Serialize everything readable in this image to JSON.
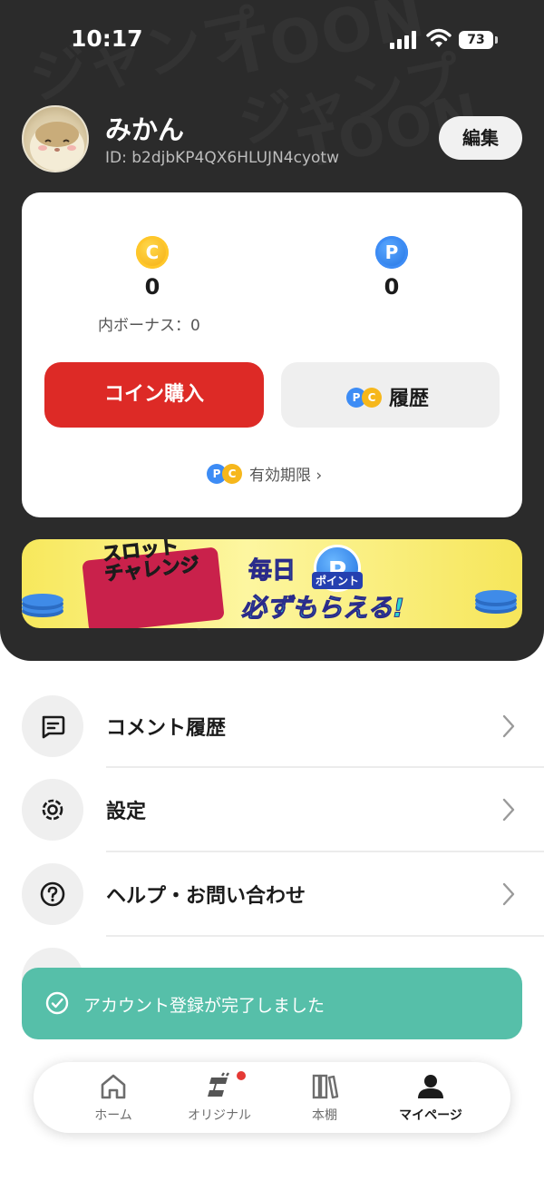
{
  "status_bar": {
    "time": "10:17",
    "battery": "73"
  },
  "profile": {
    "name": "みかん",
    "id": "ID: b2djbKP4QX6HLUJN4cyotw",
    "edit_label": "編集"
  },
  "background_words": [
    "ジャンプ",
    "TOON",
    "ジャンプ",
    "TOON",
    "ジャンプ"
  ],
  "balance": {
    "coin_icon": "C",
    "coin_value": "0",
    "coin_bonus": "内ボーナス：0",
    "point_icon": "P",
    "point_value": "0",
    "buy_label": "コイン購入",
    "history_label": "履歴",
    "expiry_label": "有効期限 ›"
  },
  "banner": {
    "title": "スロット\nチャレンジ",
    "daily": "毎日",
    "point_icon": "P",
    "point_label": "ポイント",
    "get": "必ずもらえる!"
  },
  "menu": {
    "items": [
      {
        "label": "コメント履歴",
        "icon": "comment-icon"
      },
      {
        "label": "設定",
        "icon": "gear-icon"
      },
      {
        "label": "ヘルプ・お問い合わせ",
        "icon": "help-icon"
      }
    ]
  },
  "toast": {
    "message": "アカウント登録が完了しました",
    "icon": "check-circle-icon"
  },
  "nav": {
    "items": [
      {
        "label": "ホーム",
        "icon": "home-icon"
      },
      {
        "label": "オリジナル",
        "icon": "original-icon"
      },
      {
        "label": "本棚",
        "icon": "bookshelf-icon"
      },
      {
        "label": "マイページ",
        "icon": "person-icon"
      }
    ]
  },
  "colors": {
    "header_bg": "#2b2b2b",
    "buy_button": "#dd2a26",
    "toast_bg": "#56bfa9",
    "coin_gold": "#f6b71c",
    "point_blue": "#3d8cf5"
  }
}
